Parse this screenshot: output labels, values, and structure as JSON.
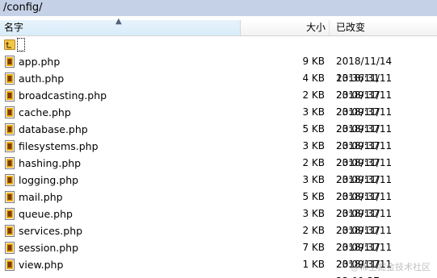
{
  "path": "/config/",
  "columns": {
    "name": "名字",
    "size": "大小",
    "modified": "已改变"
  },
  "parent_label": "..",
  "files": [
    {
      "name": "app.php",
      "size": "9 KB",
      "date": "2018/11/14 13:36:31"
    },
    {
      "name": "auth.php",
      "size": "4 KB",
      "date": "2018/11/11 23:09:37"
    },
    {
      "name": "broadcasting.php",
      "size": "2 KB",
      "date": "2018/11/11 23:09:37"
    },
    {
      "name": "cache.php",
      "size": "3 KB",
      "date": "2018/11/11 23:09:37"
    },
    {
      "name": "database.php",
      "size": "5 KB",
      "date": "2018/11/11 23:09:37"
    },
    {
      "name": "filesystems.php",
      "size": "3 KB",
      "date": "2018/11/11 23:09:37"
    },
    {
      "name": "hashing.php",
      "size": "2 KB",
      "date": "2018/11/11 23:09:37"
    },
    {
      "name": "logging.php",
      "size": "3 KB",
      "date": "2018/11/11 23:09:37"
    },
    {
      "name": "mail.php",
      "size": "5 KB",
      "date": "2018/11/11 23:09:37"
    },
    {
      "name": "queue.php",
      "size": "3 KB",
      "date": "2018/11/11 23:09:37"
    },
    {
      "name": "services.php",
      "size": "2 KB",
      "date": "2018/11/11 23:09:37"
    },
    {
      "name": "session.php",
      "size": "7 KB",
      "date": "2018/11/11 23:09:37"
    },
    {
      "name": "view.php",
      "size": "1 KB",
      "date": "2018/11/11 23:09:37"
    }
  ],
  "watermark": "@稀土掘金技术社区",
  "colors": {
    "path_bar": "#c5d1e6",
    "sorted_header": "#dcedf9",
    "file_icon": "#f0a800"
  }
}
